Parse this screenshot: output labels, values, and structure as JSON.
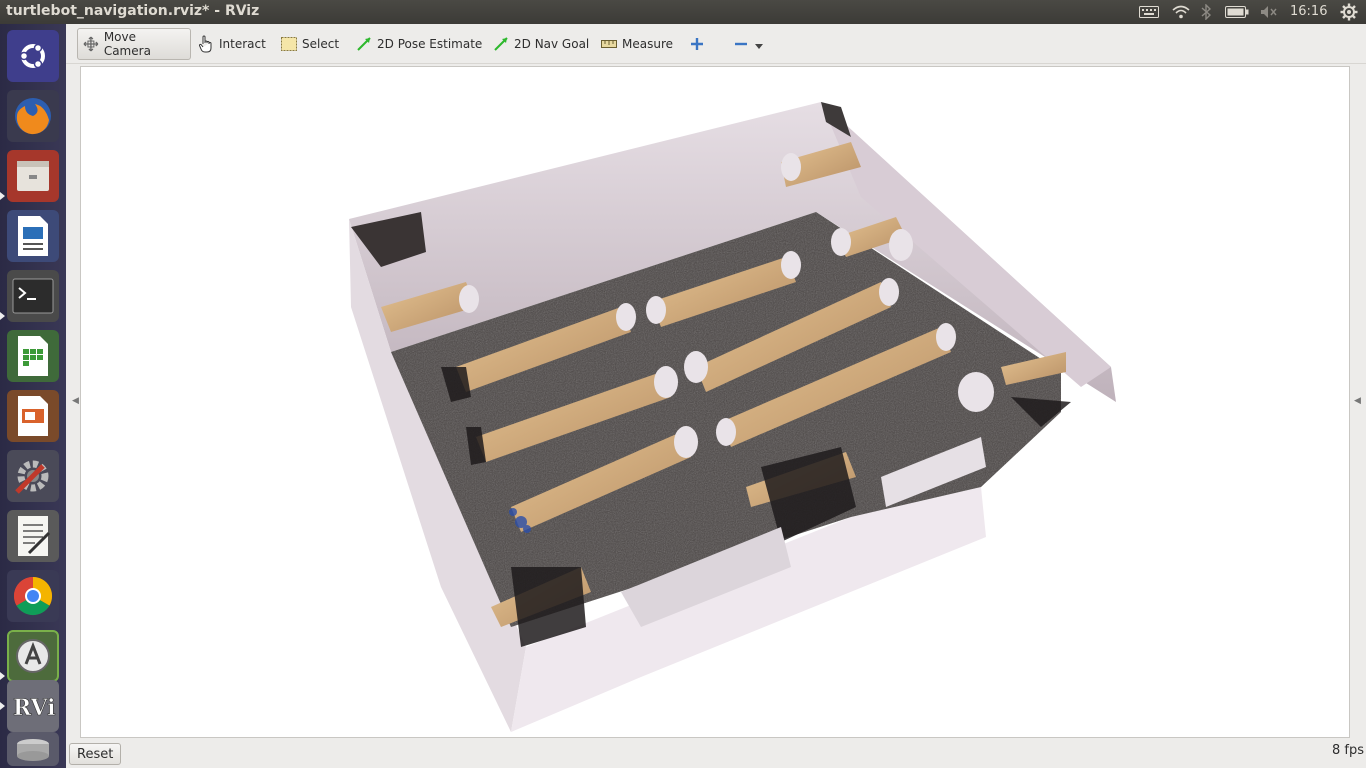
{
  "window": {
    "title": "turtlebot_navigation.rviz* - RViz"
  },
  "panel": {
    "clock": "16:16"
  },
  "launcher": {
    "items": [
      {
        "name": "ubuntu-dash-icon"
      },
      {
        "name": "firefox-icon"
      },
      {
        "name": "files-icon"
      },
      {
        "name": "libreoffice-writer-icon"
      },
      {
        "name": "terminal-icon"
      },
      {
        "name": "libreoffice-calc-icon"
      },
      {
        "name": "libreoffice-impress-icon"
      },
      {
        "name": "system-settings-icon"
      },
      {
        "name": "text-editor-icon"
      },
      {
        "name": "chrome-icon"
      },
      {
        "name": "software-updater-icon"
      },
      {
        "name": "rviz-icon",
        "label": "RViz"
      },
      {
        "name": "disk-icon"
      }
    ]
  },
  "toolbar": {
    "move_camera": "Move Camera",
    "interact": "Interact",
    "select": "Select",
    "pose_estimate": "2D Pose Estimate",
    "nav_goal": "2D Nav Goal",
    "measure": "Measure"
  },
  "status": {
    "reset": "Reset",
    "fps": "8 fps"
  },
  "colors": {
    "floor": "#4a4544",
    "wall": "#d9cfd6",
    "bench": "#d7b07f",
    "launcher_bg": "#2f2d4a"
  }
}
